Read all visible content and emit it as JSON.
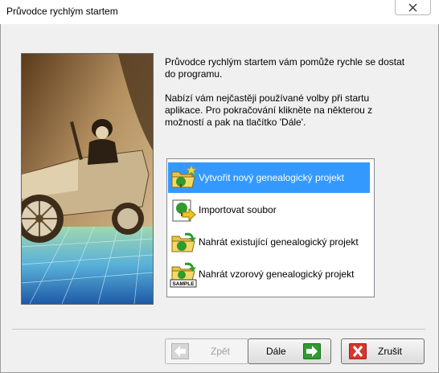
{
  "window": {
    "title": "Průvodce rychlým startem"
  },
  "intro": {
    "line1": "Průvodce rychlým startem vám pomůže rychle se dostat do programu.",
    "line2": "Nabízí vám nejčastěji používané volby při startu aplikace. Pro pokračování klikněte na některou z možností a pak na tlačítko 'Dále'."
  },
  "options": [
    {
      "label": "Vytvořit nový genealogický projekt",
      "icon": "new-project-icon",
      "selected": true
    },
    {
      "label": "Importovat soubor",
      "icon": "import-file-icon",
      "selected": false
    },
    {
      "label": "Nahrát existující genealogický projekt",
      "icon": "open-project-icon",
      "selected": false
    },
    {
      "label": "Nahrát vzorový genealogický projekt",
      "icon": "sample-project-icon",
      "selected": false
    }
  ],
  "sample_badge": "SAMPLE",
  "buttons": {
    "back": "Zpět",
    "next": "Dále",
    "cancel": "Zrušit"
  },
  "colors": {
    "selection": "#3399ff",
    "next_arrow": "#2e9b2e",
    "cancel_icon": "#d9362b"
  }
}
